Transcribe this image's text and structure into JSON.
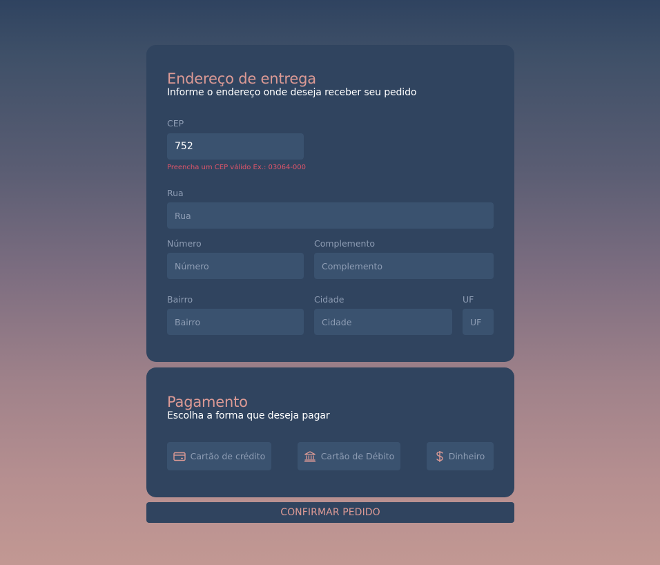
{
  "address": {
    "title": "Endereço de entrega",
    "subtitle": "Informe o endereço onde deseja receber seu pedido",
    "cep": {
      "label": "CEP",
      "value": "752",
      "error": "Preencha um CEP válido Ex.: 03064-000"
    },
    "rua": {
      "label": "Rua",
      "placeholder": "Rua"
    },
    "numero": {
      "label": "Número",
      "placeholder": "Número"
    },
    "complemento": {
      "label": "Complemento",
      "placeholder": "Complemento"
    },
    "bairro": {
      "label": "Bairro",
      "placeholder": "Bairro"
    },
    "cidade": {
      "label": "Cidade",
      "placeholder": "Cidade"
    },
    "uf": {
      "label": "UF",
      "placeholder": "UF"
    }
  },
  "payment": {
    "title": "Pagamento",
    "subtitle": "Escolha a forma que deseja pagar",
    "options": [
      {
        "label": "Cartão de crédito",
        "icon": "credit-card-icon"
      },
      {
        "label": "Cartão de Débito",
        "icon": "bank-icon"
      },
      {
        "label": "Dinheiro",
        "icon": "dollar-icon"
      }
    ]
  },
  "confirm_label": "CONFIRMAR PEDIDO",
  "colors": {
    "card": "#30445f",
    "field": "#3a526f",
    "accent": "#dc9a95",
    "error": "#e0556a",
    "muted": "#8e9db4"
  }
}
